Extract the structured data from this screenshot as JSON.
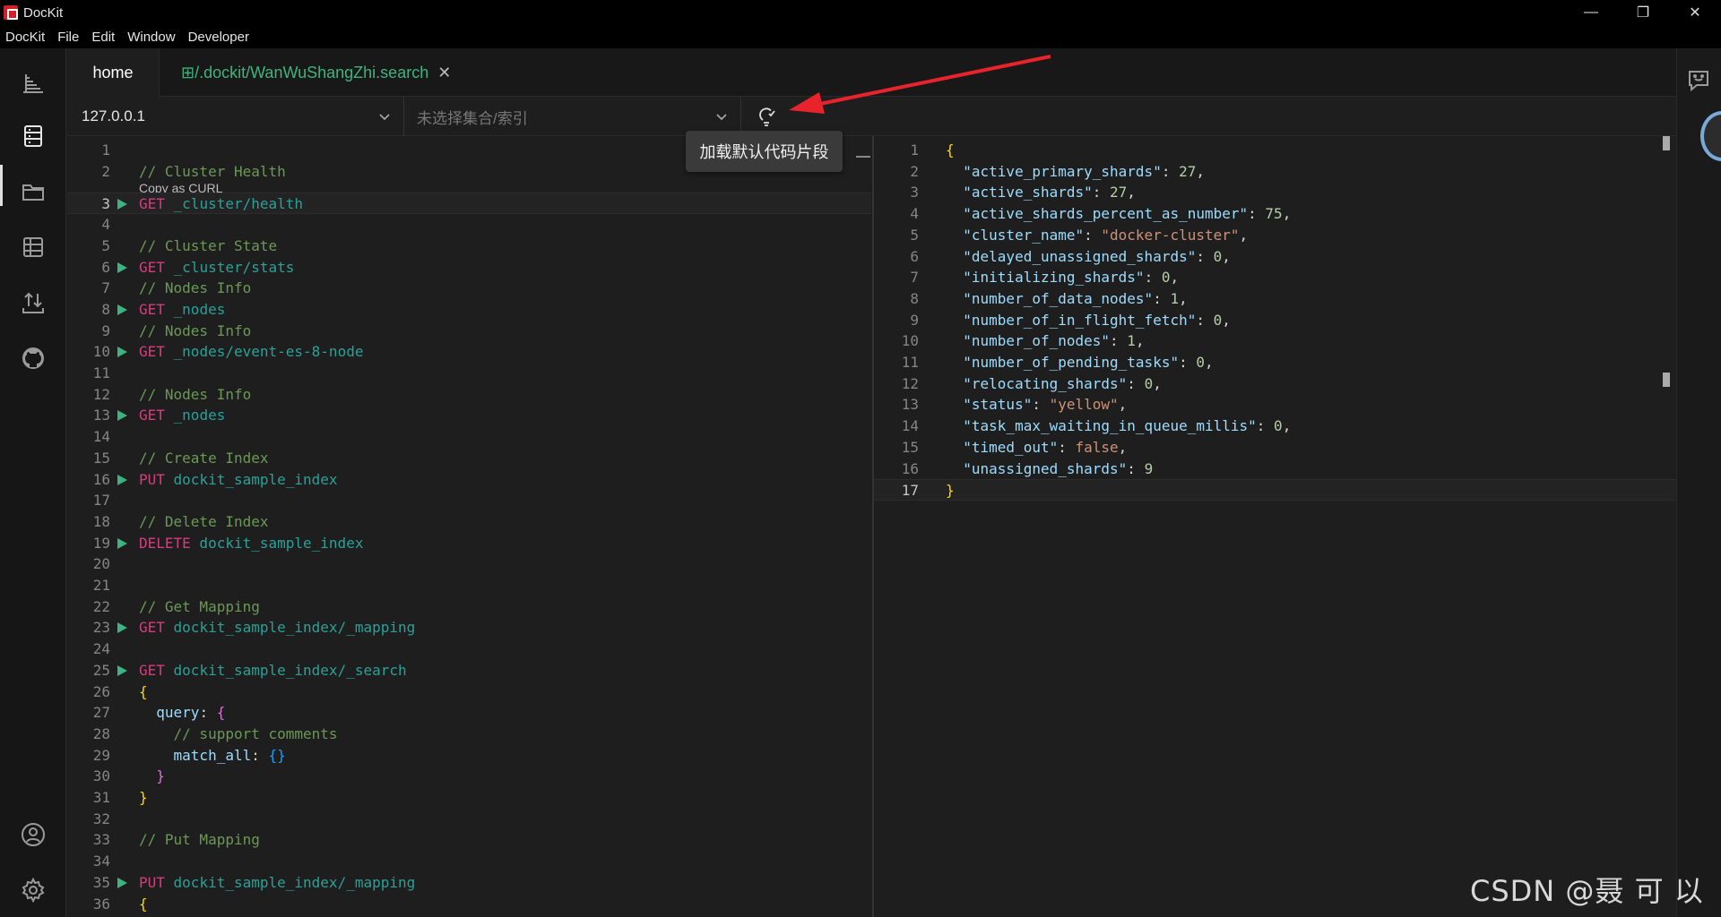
{
  "window": {
    "title": "DocKit",
    "minimize": "—",
    "maximize": "❐",
    "close": "✕"
  },
  "menu": [
    "DocKit",
    "File",
    "Edit",
    "Window",
    "Developer"
  ],
  "tabs": [
    {
      "label": "home",
      "active": true
    },
    {
      "label": "⊞/.dockit/WanWuShangZhi.search",
      "close": "✕"
    }
  ],
  "toolbar": {
    "host": "127.0.0.1",
    "index_placeholder": "未选择集合/索引",
    "tooltip": "加载默认代码片段"
  },
  "activity_icons": [
    "bar-chart-icon",
    "database-icon",
    "folder-icon",
    "index-list-icon",
    "import-export-icon",
    "github-icon",
    "user-icon",
    "settings-icon"
  ],
  "left_editor": {
    "copy_as_curl": "Copy as CURL",
    "lines": [
      {
        "n": "1"
      },
      {
        "n": "2",
        "tokens": [
          [
            "com",
            "// Cluster Health"
          ]
        ]
      },
      {
        "n": "3",
        "run": true,
        "current": true,
        "tokens": [
          [
            "get",
            "GET"
          ],
          [
            "path",
            " _cluster/health"
          ]
        ]
      },
      {
        "n": "4"
      },
      {
        "n": "5",
        "tokens": [
          [
            "com",
            "// Cluster State"
          ]
        ]
      },
      {
        "n": "6",
        "run": true,
        "tokens": [
          [
            "get",
            "GET"
          ],
          [
            "path",
            " _cluster/stats"
          ]
        ]
      },
      {
        "n": "7",
        "tokens": [
          [
            "com",
            "// Nodes Info"
          ]
        ]
      },
      {
        "n": "8",
        "run": true,
        "tokens": [
          [
            "get",
            "GET"
          ],
          [
            "path",
            " _nodes"
          ]
        ]
      },
      {
        "n": "9",
        "tokens": [
          [
            "com",
            "// Nodes Info"
          ]
        ]
      },
      {
        "n": "10",
        "run": true,
        "tokens": [
          [
            "get",
            "GET"
          ],
          [
            "path",
            " _nodes/event-es-8-node"
          ]
        ]
      },
      {
        "n": "11"
      },
      {
        "n": "12",
        "tokens": [
          [
            "com",
            "// Nodes Info"
          ]
        ]
      },
      {
        "n": "13",
        "run": true,
        "tokens": [
          [
            "get",
            "GET"
          ],
          [
            "path",
            " _nodes"
          ]
        ]
      },
      {
        "n": "14"
      },
      {
        "n": "15",
        "tokens": [
          [
            "com",
            "// Create Index"
          ]
        ]
      },
      {
        "n": "16",
        "run": true,
        "tokens": [
          [
            "get",
            "PUT"
          ],
          [
            "path",
            " dockit_sample_index"
          ]
        ]
      },
      {
        "n": "17"
      },
      {
        "n": "18",
        "tokens": [
          [
            "com",
            "// Delete Index"
          ]
        ]
      },
      {
        "n": "19",
        "run": true,
        "tokens": [
          [
            "get",
            "DELETE"
          ],
          [
            "path",
            " dockit_sample_index"
          ]
        ]
      },
      {
        "n": "20"
      },
      {
        "n": "21"
      },
      {
        "n": "22",
        "tokens": [
          [
            "com",
            "// Get Mapping"
          ]
        ]
      },
      {
        "n": "23",
        "run": true,
        "tokens": [
          [
            "get",
            "GET"
          ],
          [
            "path",
            " dockit_sample_index/_mapping"
          ]
        ]
      },
      {
        "n": "24"
      },
      {
        "n": "25",
        "run": true,
        "tokens": [
          [
            "get",
            "GET"
          ],
          [
            "path",
            " dockit_sample_index/_search"
          ]
        ]
      },
      {
        "n": "26",
        "tokens": [
          [
            "brace",
            "{"
          ]
        ]
      },
      {
        "n": "27",
        "tokens": [
          [
            "plain",
            "  "
          ],
          [
            "key",
            "query"
          ],
          [
            "plain",
            ": "
          ],
          [
            "brace2",
            "{"
          ]
        ]
      },
      {
        "n": "28",
        "tokens": [
          [
            "plain",
            "    "
          ],
          [
            "com",
            "// support comments"
          ]
        ]
      },
      {
        "n": "29",
        "tokens": [
          [
            "plain",
            "    "
          ],
          [
            "key",
            "match_all"
          ],
          [
            "plain",
            ": "
          ],
          [
            "brace3",
            "{}"
          ]
        ]
      },
      {
        "n": "30",
        "tokens": [
          [
            "plain",
            "  "
          ],
          [
            "brace2",
            "}"
          ]
        ]
      },
      {
        "n": "31",
        "tokens": [
          [
            "brace",
            "}"
          ]
        ]
      },
      {
        "n": "32"
      },
      {
        "n": "33",
        "tokens": [
          [
            "com",
            "// Put Mapping"
          ]
        ]
      },
      {
        "n": "34"
      },
      {
        "n": "35",
        "run": true,
        "tokens": [
          [
            "get",
            "PUT"
          ],
          [
            "path",
            " dockit_sample_index/_mapping"
          ]
        ]
      },
      {
        "n": "36",
        "tokens": [
          [
            "brace",
            "{"
          ]
        ]
      }
    ]
  },
  "right_editor": {
    "lines": [
      {
        "n": "1",
        "tokens": [
          [
            "brace",
            "{"
          ]
        ]
      },
      {
        "n": "2",
        "tokens": [
          [
            "plain",
            "  "
          ],
          [
            "key",
            "\"active_primary_shards\""
          ],
          [
            "plain",
            ": "
          ],
          [
            "num",
            "27"
          ],
          [
            "plain",
            ","
          ]
        ]
      },
      {
        "n": "3",
        "tokens": [
          [
            "plain",
            "  "
          ],
          [
            "key",
            "\"active_shards\""
          ],
          [
            "plain",
            ": "
          ],
          [
            "num",
            "27"
          ],
          [
            "plain",
            ","
          ]
        ]
      },
      {
        "n": "4",
        "tokens": [
          [
            "plain",
            "  "
          ],
          [
            "key",
            "\"active_shards_percent_as_number\""
          ],
          [
            "plain",
            ": "
          ],
          [
            "num",
            "75"
          ],
          [
            "plain",
            ","
          ]
        ]
      },
      {
        "n": "5",
        "tokens": [
          [
            "plain",
            "  "
          ],
          [
            "key",
            "\"cluster_name\""
          ],
          [
            "plain",
            ": "
          ],
          [
            "str",
            "\"docker-cluster\""
          ],
          [
            "plain",
            ","
          ]
        ]
      },
      {
        "n": "6",
        "tokens": [
          [
            "plain",
            "  "
          ],
          [
            "key",
            "\"delayed_unassigned_shards\""
          ],
          [
            "plain",
            ": "
          ],
          [
            "num",
            "0"
          ],
          [
            "plain",
            ","
          ]
        ]
      },
      {
        "n": "7",
        "tokens": [
          [
            "plain",
            "  "
          ],
          [
            "key",
            "\"initializing_shards\""
          ],
          [
            "plain",
            ": "
          ],
          [
            "num",
            "0"
          ],
          [
            "plain",
            ","
          ]
        ]
      },
      {
        "n": "8",
        "tokens": [
          [
            "plain",
            "  "
          ],
          [
            "key",
            "\"number_of_data_nodes\""
          ],
          [
            "plain",
            ": "
          ],
          [
            "num",
            "1"
          ],
          [
            "plain",
            ","
          ]
        ]
      },
      {
        "n": "9",
        "tokens": [
          [
            "plain",
            "  "
          ],
          [
            "key",
            "\"number_of_in_flight_fetch\""
          ],
          [
            "plain",
            ": "
          ],
          [
            "num",
            "0"
          ],
          [
            "plain",
            ","
          ]
        ]
      },
      {
        "n": "10",
        "tokens": [
          [
            "plain",
            "  "
          ],
          [
            "key",
            "\"number_of_nodes\""
          ],
          [
            "plain",
            ": "
          ],
          [
            "num",
            "1"
          ],
          [
            "plain",
            ","
          ]
        ]
      },
      {
        "n": "11",
        "tokens": [
          [
            "plain",
            "  "
          ],
          [
            "key",
            "\"number_of_pending_tasks\""
          ],
          [
            "plain",
            ": "
          ],
          [
            "num",
            "0"
          ],
          [
            "plain",
            ","
          ]
        ]
      },
      {
        "n": "12",
        "tokens": [
          [
            "plain",
            "  "
          ],
          [
            "key",
            "\"relocating_shards\""
          ],
          [
            "plain",
            ": "
          ],
          [
            "num",
            "0"
          ],
          [
            "plain",
            ","
          ]
        ]
      },
      {
        "n": "13",
        "tokens": [
          [
            "plain",
            "  "
          ],
          [
            "key",
            "\"status\""
          ],
          [
            "plain",
            ": "
          ],
          [
            "str",
            "\"yellow\""
          ],
          [
            "plain",
            ","
          ]
        ]
      },
      {
        "n": "14",
        "tokens": [
          [
            "plain",
            "  "
          ],
          [
            "key",
            "\"task_max_waiting_in_queue_millis\""
          ],
          [
            "plain",
            ": "
          ],
          [
            "num",
            "0"
          ],
          [
            "plain",
            ","
          ]
        ]
      },
      {
        "n": "15",
        "tokens": [
          [
            "plain",
            "  "
          ],
          [
            "key",
            "\"timed_out\""
          ],
          [
            "plain",
            ": "
          ],
          [
            "bool",
            "false"
          ],
          [
            "plain",
            ","
          ]
        ]
      },
      {
        "n": "16",
        "tokens": [
          [
            "plain",
            "  "
          ],
          [
            "key",
            "\"unassigned_shards\""
          ],
          [
            "plain",
            ": "
          ],
          [
            "num",
            "9"
          ]
        ]
      },
      {
        "n": "17",
        "current": true,
        "tokens": [
          [
            "brace",
            "}"
          ]
        ]
      }
    ]
  },
  "watermark": "CSDN @聂 可 以"
}
